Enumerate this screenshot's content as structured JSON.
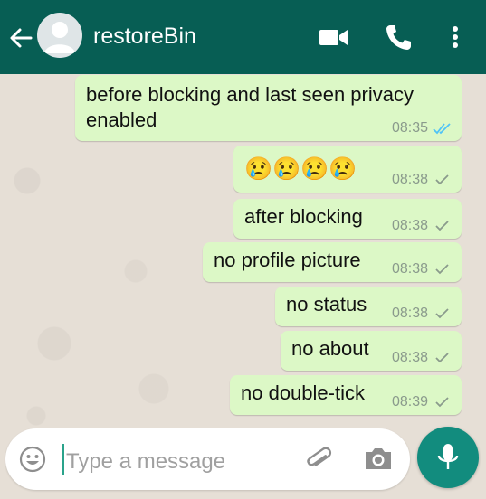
{
  "header": {
    "contact_name": "restoreBin",
    "icons": [
      "back-arrow-icon",
      "avatar",
      "video-call-icon",
      "phone-icon",
      "more-vert-icon"
    ]
  },
  "messages": [
    {
      "text_line1": "before blocking and last seen privacy",
      "text_line2": "enabled",
      "time": "08:35",
      "status": "read"
    },
    {
      "text": "😢😢😢😢",
      "time": "08:38",
      "status": "sent"
    },
    {
      "text": "after blocking",
      "time": "08:38",
      "status": "sent"
    },
    {
      "text": "no profile picture",
      "time": "08:38",
      "status": "sent"
    },
    {
      "text": "no status",
      "time": "08:38",
      "status": "sent"
    },
    {
      "text": "no about",
      "time": "08:38",
      "status": "sent"
    },
    {
      "text": "no double-tick",
      "time": "08:39",
      "status": "sent"
    }
  ],
  "composer": {
    "placeholder": "Type a message",
    "icons": [
      "emoji-icon",
      "attach-icon",
      "camera-icon",
      "mic-icon"
    ]
  },
  "colors": {
    "header": "#075e54",
    "outgoing_bubble": "#dcf8c6",
    "read_tick": "#4fc3f7",
    "mic_button": "#128c7e"
  }
}
